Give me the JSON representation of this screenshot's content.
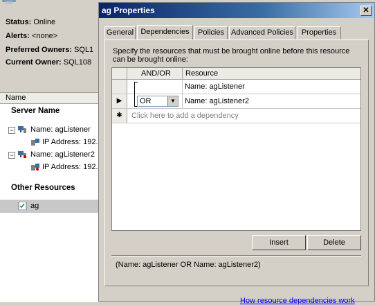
{
  "background": {
    "summary": [
      {
        "label": "Status:",
        "value": "Online"
      },
      {
        "label": "Alerts:",
        "value": "<none>"
      },
      {
        "label": "Preferred Owners:",
        "value": "SQL1"
      },
      {
        "label": "Current Owner:",
        "value": "SQL108"
      }
    ],
    "resources_header": "Name",
    "server_name_title": "Server Name",
    "server_items": [
      {
        "label": "Name: agListener",
        "child": "IP Address: 192."
      },
      {
        "label": "Name: agListener2",
        "child": "IP Address: 192."
      }
    ],
    "other_resources_title": "Other Resources",
    "other_items": [
      {
        "label": "ag"
      }
    ]
  },
  "dialog": {
    "title": "ag Properties",
    "close_glyph": "✕",
    "tabs": [
      {
        "label": "General"
      },
      {
        "label": "Dependencies",
        "active": true
      },
      {
        "label": "Policies"
      },
      {
        "label": "Advanced Policies"
      },
      {
        "label": "Properties"
      }
    ],
    "instruction": "Specify the resources that must be brought online before this resource can be brought online:",
    "grid": {
      "columns": [
        "AND/OR",
        "Resource"
      ],
      "rows": [
        {
          "marker": "",
          "andor": "",
          "resource": "Name: agListener"
        },
        {
          "marker": "▶",
          "andor": "OR",
          "resource": "Name: agListener2"
        }
      ],
      "new_row_marker": "✱",
      "new_row_placeholder": "Click here to add a dependency"
    },
    "buttons": {
      "insert": "Insert",
      "delete": "Delete"
    },
    "expression": "(Name: agListener OR Name: agListener2)",
    "help_link": "How resource dependencies work"
  }
}
